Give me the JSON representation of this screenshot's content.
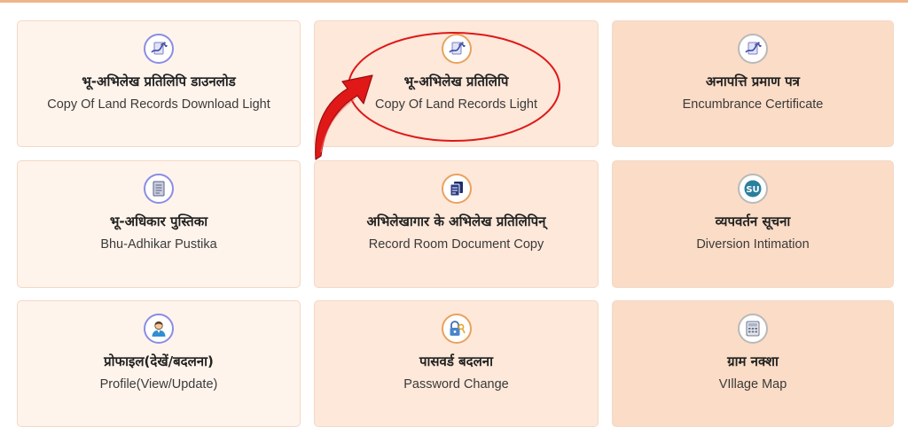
{
  "colors": {
    "accent_border": "#f0b48a",
    "card_light": "#fff4ec",
    "card_mid": "#fde8da",
    "card_dark": "#fbdcc6",
    "annotation_red": "#e01818"
  },
  "cards": [
    {
      "hi": "भू-अभिलेख प्रतिलिपि डाउनलोड",
      "en": "Copy Of Land Records Download Light",
      "icon": "document-sign-icon"
    },
    {
      "hi": "भू-अभिलेख प्रतिलिपि",
      "en": "Copy Of Land Records Light",
      "icon": "document-sign-icon"
    },
    {
      "hi": "अनापत्ति प्रमाण पत्र",
      "en": "Encumbrance Certificate",
      "icon": "document-sign-icon"
    },
    {
      "hi": "भू-अधिकार पुस्तिका",
      "en": "Bhu-Adhikar Pustika",
      "icon": "booklet-icon"
    },
    {
      "hi": "अभिलेखागार के अभिलेख प्रतिलिपिन्",
      "en": "Record Room Document Copy",
      "icon": "copy-document-icon"
    },
    {
      "hi": "व्यपवर्तन सूचना",
      "en": "Diversion Intimation",
      "icon": "stumble-badge-icon"
    },
    {
      "hi": "प्रोफाइल(देखें/बदलना)",
      "en": "Profile(View/Update)",
      "icon": "user-profile-icon"
    },
    {
      "hi": "पासवर्ड बदलना",
      "en": "Password Change",
      "icon": "lock-key-icon"
    },
    {
      "hi": "ग्राम नक्शा",
      "en": "VIllage Map",
      "icon": "calculator-map-icon"
    }
  ]
}
